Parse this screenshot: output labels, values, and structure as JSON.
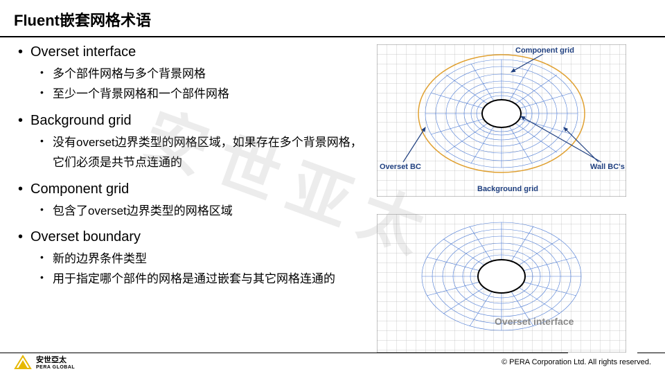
{
  "slide": {
    "title": "Fluent嵌套网格术语",
    "bullets": [
      {
        "heading": "Overset interface",
        "subs": [
          "多个部件网格与多个背景网格",
          "至少一个背景网格和一个部件网格"
        ]
      },
      {
        "heading": "Background grid",
        "subs": [
          "没有overset边界类型的网格区域，如果存在多个背景网格，它们必须是共节点连通的"
        ]
      },
      {
        "heading": "Component grid",
        "subs": [
          "包含了overset边界类型的网格区域"
        ]
      },
      {
        "heading": "Overset boundary",
        "subs": [
          "新的边界条件类型",
          "用于指定哪个部件的网格是通过嵌套与其它网格连通的"
        ]
      }
    ]
  },
  "diagrams": {
    "top": {
      "labels": {
        "component": "Component grid",
        "overset_bc": "Overset BC",
        "wall_bc": "Wall BC's",
        "background": "Background grid"
      }
    },
    "bottom": {
      "labels": {
        "overset_if": "Overset interface"
      }
    }
  },
  "watermark": "安世亚太",
  "footer": {
    "company": "安世亞太",
    "company_sub": "PERA GLOBAL",
    "copyright": "© PERA Corporation Ltd. All rights reserved."
  }
}
